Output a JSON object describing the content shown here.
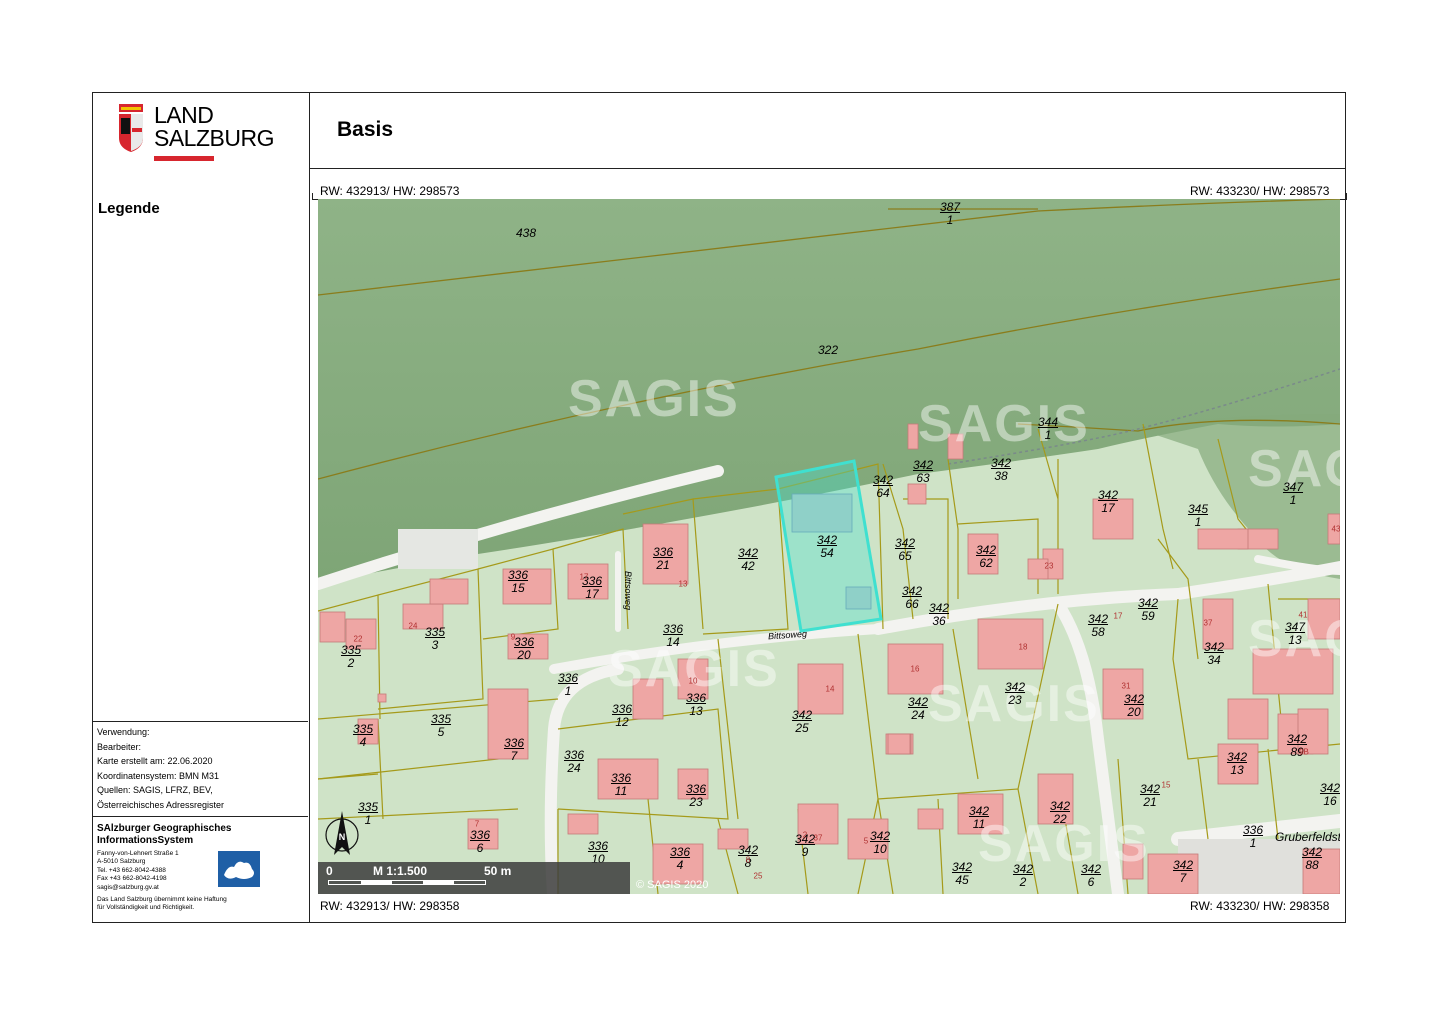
{
  "header": {
    "title": "Basis"
  },
  "logo": {
    "line1": "LAND",
    "line2": "SALZBURG",
    "icon": "salzburg-coat-of-arms-icon"
  },
  "sidebar": {
    "legend_title": "Legende",
    "meta": [
      "Verwendung:",
      "Bearbeiter:",
      "Karte erstellt am: 22.06.2020",
      "Koordinatensystem: BMN M31",
      "Quellen: SAGIS, LFRZ, BEV,",
      "Österreichisches Adressregister"
    ],
    "org": {
      "name_line1": "SAlzburger Geographisches",
      "name_line2": "InformationsSystem",
      "address": [
        "Fanny-von-Lehnert Straße 1",
        "A-5010 Salzburg",
        "Tel.   +43 662-8042-4388",
        "Fax   +43 662-8042-4198",
        "sagis@salzburg.gv.at"
      ],
      "disclaimer_line1": "Das Land Salzburg übernimmt keine Haftung",
      "disclaimer_line2": "für Vollständigkeit und Richtigkeit.",
      "logo_icon": "sagis-logo-icon"
    }
  },
  "coords": {
    "top_left": "RW: 432913/ HW: 298573",
    "top_right": "RW: 433230/ HW: 298573",
    "bottom_left": "RW: 432913/ HW: 298358",
    "bottom_right": "RW: 433230/ HW: 298358"
  },
  "map": {
    "watermark": "SAGIS",
    "scale": {
      "start": "0",
      "ratio": "M 1:1.500",
      "end": "50 m"
    },
    "copyright": "© SAGIS 2020",
    "north_label": "N",
    "street_labels": [
      "Bittsoweg",
      "Bittsoweg",
      "Gruberfeldst"
    ],
    "highlight_color": "#3fe0d0",
    "parcels": [
      {
        "n": "438",
        "d": ""
      },
      {
        "n": "387",
        "d": "1"
      },
      {
        "n": "322",
        "d": ""
      },
      {
        "n": "344",
        "d": "1"
      },
      {
        "n": "342",
        "d": "38"
      },
      {
        "n": "342",
        "d": "64"
      },
      {
        "n": "342",
        "d": "63"
      },
      {
        "n": "342",
        "d": "17"
      },
      {
        "n": "345",
        "d": "1"
      },
      {
        "n": "347",
        "d": "1"
      },
      {
        "n": "342",
        "d": "54"
      },
      {
        "n": "342",
        "d": "42"
      },
      {
        "n": "336",
        "d": "21"
      },
      {
        "n": "342",
        "d": "65"
      },
      {
        "n": "342",
        "d": "62"
      },
      {
        "n": "336",
        "d": "15"
      },
      {
        "n": "336",
        "d": "17"
      },
      {
        "n": "342",
        "d": "66"
      },
      {
        "n": "342",
        "d": "36"
      },
      {
        "n": "342",
        "d": "59"
      },
      {
        "n": "342",
        "d": "58"
      },
      {
        "n": "347",
        "d": "13"
      },
      {
        "n": "335",
        "d": "3"
      },
      {
        "n": "335",
        "d": "2"
      },
      {
        "n": "336",
        "d": "20"
      },
      {
        "n": "336",
        "d": "14"
      },
      {
        "n": "342",
        "d": "34"
      },
      {
        "n": "336",
        "d": "1"
      },
      {
        "n": "336",
        "d": "12"
      },
      {
        "n": "336",
        "d": "13"
      },
      {
        "n": "342",
        "d": "25"
      },
      {
        "n": "342",
        "d": "24"
      },
      {
        "n": "342",
        "d": "23"
      },
      {
        "n": "342",
        "d": "20"
      },
      {
        "n": "335",
        "d": "4"
      },
      {
        "n": "335",
        "d": "5"
      },
      {
        "n": "336",
        "d": "7"
      },
      {
        "n": "336",
        "d": "24"
      },
      {
        "n": "342",
        "d": "89"
      },
      {
        "n": "342",
        "d": "13"
      },
      {
        "n": "336",
        "d": "11"
      },
      {
        "n": "336",
        "d": "23"
      },
      {
        "n": "342",
        "d": "21"
      },
      {
        "n": "342",
        "d": "16"
      },
      {
        "n": "335",
        "d": "1"
      },
      {
        "n": "336",
        "d": "6"
      },
      {
        "n": "342",
        "d": "11"
      },
      {
        "n": "342",
        "d": "22"
      },
      {
        "n": "336",
        "d": "1"
      },
      {
        "n": "342",
        "d": "9"
      },
      {
        "n": "342",
        "d": "10"
      },
      {
        "n": "336",
        "d": "10"
      },
      {
        "n": "336",
        "d": "4"
      },
      {
        "n": "342",
        "d": "8"
      },
      {
        "n": "342",
        "d": "45"
      },
      {
        "n": "342",
        "d": "2"
      },
      {
        "n": "342",
        "d": "6"
      },
      {
        "n": "342",
        "d": "7"
      },
      {
        "n": "342",
        "d": "88"
      }
    ],
    "house_numbers": [
      "13",
      "22",
      "24",
      "9",
      "10",
      "17",
      "16",
      "14",
      "18",
      "23",
      "37",
      "41",
      "31",
      "15",
      "9B",
      "7",
      "5",
      "2",
      "37",
      "25",
      "43",
      "17",
      "8"
    ]
  }
}
